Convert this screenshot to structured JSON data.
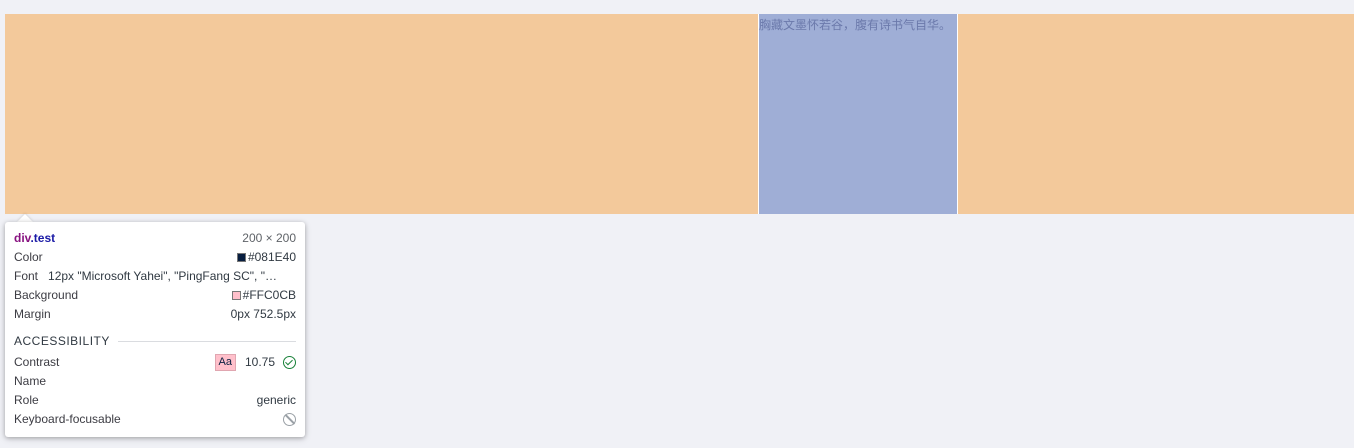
{
  "target": {
    "text": "胸藏文墨怀若谷，腹有诗书气自华。"
  },
  "tooltip": {
    "selector_tag": "div",
    "selector_class": ".test",
    "dimensions": "200 × 200",
    "color_label": "Color",
    "color_value": "#081E40",
    "font_label": "Font",
    "font_value": "12px \"Microsoft Yahei\", \"PingFang SC\", \"…",
    "background_label": "Background",
    "background_value": "#FFC0CB",
    "margin_label": "Margin",
    "margin_value": "0px 752.5px",
    "accessibility_title": "ACCESSIBILITY",
    "contrast_label": "Contrast",
    "contrast_badge": "Aa",
    "contrast_value": "10.75",
    "name_label": "Name",
    "role_label": "Role",
    "role_value": "generic",
    "keyboard_label": "Keyboard-focusable"
  },
  "colors": {
    "swatch_color": "#081E40",
    "swatch_background": "#FFC0CB",
    "margin_highlight": "#F3C99B",
    "content_highlight": "#9FAED6"
  }
}
